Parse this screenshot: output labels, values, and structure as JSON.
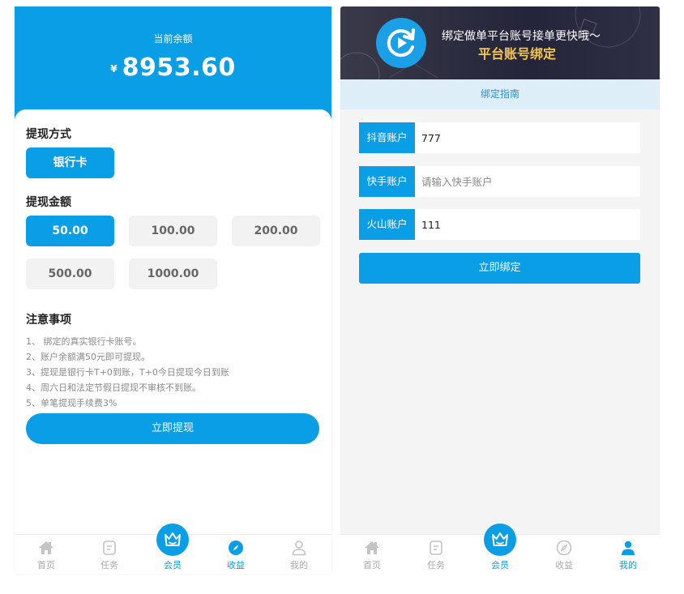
{
  "withdraw_screen": {
    "balance_label": "当前余额",
    "currency_symbol": "¥",
    "balance": "8953.60",
    "method_title": "提现方式",
    "method_option": "银行卡",
    "amount_title": "提现金额",
    "amounts": [
      "50.00",
      "100.00",
      "200.00",
      "500.00",
      "1000.00"
    ],
    "selected_amount": "50.00",
    "notes_title": "注意事项",
    "notes": [
      "1、 绑定的真实银行卡账号。",
      "2、账户余额满50元即可提现。",
      "3、提现是银行卡T+0到账，T+0今日提现今日到账",
      "4、周六日和法定节假日提现不审核不到账。",
      "5、单笔提现手续费3%"
    ],
    "submit_label": "立即提现",
    "tabbar": [
      {
        "label": "首页",
        "icon": "home-icon",
        "active": false
      },
      {
        "label": "任务",
        "icon": "task-icon",
        "active": false
      },
      {
        "label": "会员",
        "icon": "crown-icon",
        "active": true,
        "raised": true
      },
      {
        "label": "收益",
        "icon": "compass-icon",
        "active": true
      },
      {
        "label": "我的",
        "icon": "user-icon",
        "active": false
      }
    ]
  },
  "bind_screen": {
    "banner_line1": "绑定做单平台账号接单更快哦～",
    "banner_line2": "平台账号绑定",
    "guide_label": "绑定指南",
    "accounts": [
      {
        "label": "抖音账户",
        "value": "777",
        "placeholder": ""
      },
      {
        "label": "快手账户",
        "value": "",
        "placeholder": "请输入快手账户"
      },
      {
        "label": "火山账户",
        "value": "111",
        "placeholder": ""
      }
    ],
    "submit_label": "立即绑定",
    "tabbar": [
      {
        "label": "首页",
        "icon": "home-icon",
        "active": false
      },
      {
        "label": "任务",
        "icon": "task-icon",
        "active": false
      },
      {
        "label": "会员",
        "icon": "crown-icon",
        "active": true,
        "raised": true
      },
      {
        "label": "收益",
        "icon": "compass-icon",
        "active": false
      },
      {
        "label": "我的",
        "icon": "user-icon",
        "active": true
      }
    ]
  },
  "colors": {
    "primary": "#0a9ee6",
    "banner_highlight": "#f6c64a",
    "guide_bg": "#ddeef8"
  }
}
